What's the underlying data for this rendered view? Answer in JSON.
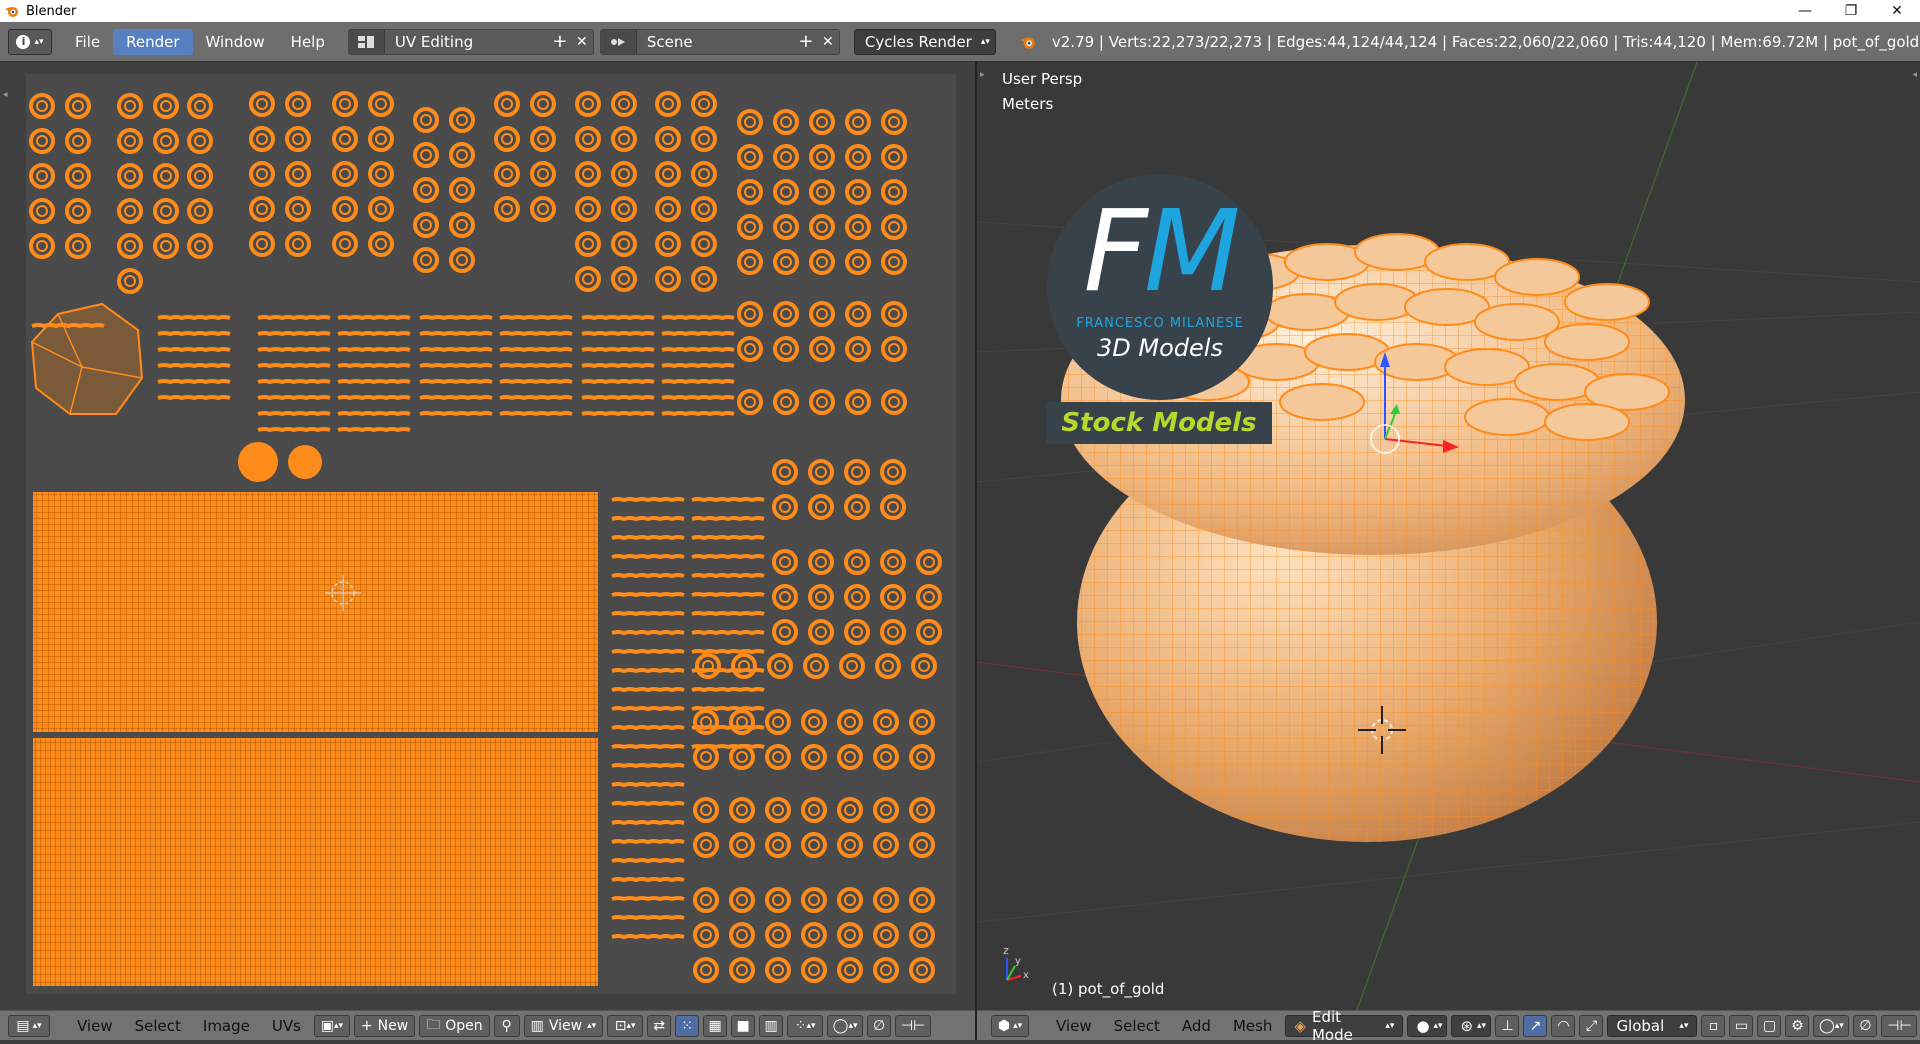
{
  "window": {
    "title": "Blender",
    "minimize": "—",
    "restore": "❐",
    "close": "✕"
  },
  "menu": [
    {
      "label": "File"
    },
    {
      "label": "Render"
    },
    {
      "label": "Window"
    },
    {
      "label": "Help"
    }
  ],
  "header": {
    "info_icon": "i",
    "screen_layout": "UV Editing",
    "scene": "Scene",
    "engine": "Cycles Render",
    "stats": "v2.79 | Verts:22,273/22,273 | Edges:44,124/44,124 | Faces:22,060/22,060 | Tris:44,120 | Mem:69.72M | pot_of_gold"
  },
  "viewport": {
    "view_name": "User Persp",
    "units": "Meters",
    "object_label": "(1) pot_of_gold",
    "logo_name": "FRANCESCO MILANESE",
    "logo_sub": "3D Models",
    "logo_letters": "FM",
    "stock_label": "Stock Models"
  },
  "uv_footer": {
    "view": "View",
    "select": "Select",
    "image": "Image",
    "uvs": "UVs",
    "new": "New",
    "open": "Open",
    "view_dropdown": "View"
  },
  "vp_footer": {
    "view": "View",
    "select": "Select",
    "add": "Add",
    "mesh": "Mesh",
    "mode": "Edit Mode",
    "orientation": "Global"
  },
  "colors": {
    "accent": "#5680c2",
    "uv_orange": "#ff8c1a",
    "mesh_orange": "#f7a54b",
    "brand_blue": "#1ea5e0",
    "brand_green": "#b9d82c"
  },
  "icons": [
    "info-icon",
    "screen-layout-icon",
    "scene-icon",
    "blender-icon",
    "editor-type-icon",
    "pin-icon",
    "cursor-icon",
    "sync-icon",
    "vertex-select-icon",
    "edge-select-icon",
    "face-select-icon",
    "island-select-icon",
    "pivot-icon",
    "proportional-icon",
    "snap-icon",
    "shading-icon",
    "manipulator-icon",
    "layers-icon"
  ]
}
